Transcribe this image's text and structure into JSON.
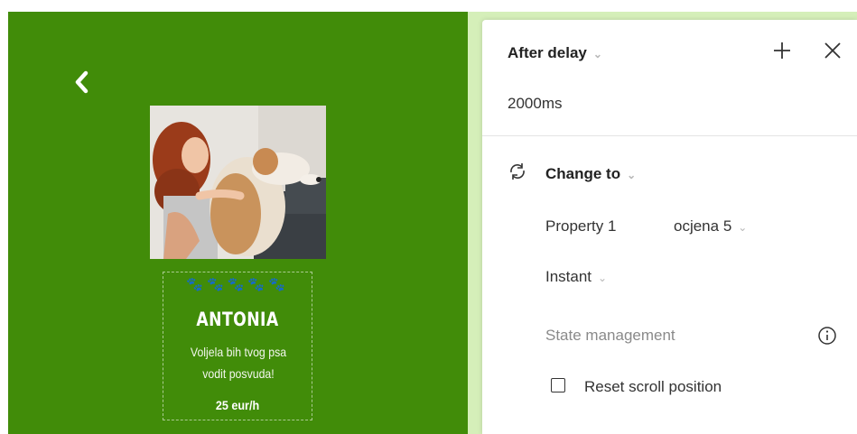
{
  "card": {
    "paws": "🐾🐾🐾🐾🐾",
    "name": "ANTONIA",
    "description_line1": "Voljela bih tvog psa",
    "description_line2": "vodit posvuda!",
    "price": "25 eur/h",
    "colors": {
      "canvas": "#418c09",
      "text": "#ffffff"
    }
  },
  "panel": {
    "trigger_label": "After delay",
    "delay_value": "2000ms",
    "action_label": "Change to",
    "property_name": "Property 1",
    "property_value": "ocjena 5",
    "animation_label": "Instant",
    "state_management_label": "State management",
    "reset_scroll_label": "Reset scroll position",
    "reset_scroll_checked": false
  },
  "icons": {
    "back": "chevron-left-icon",
    "add": "plus-icon",
    "close": "close-icon",
    "change": "swap-icon",
    "info": "info-icon"
  }
}
